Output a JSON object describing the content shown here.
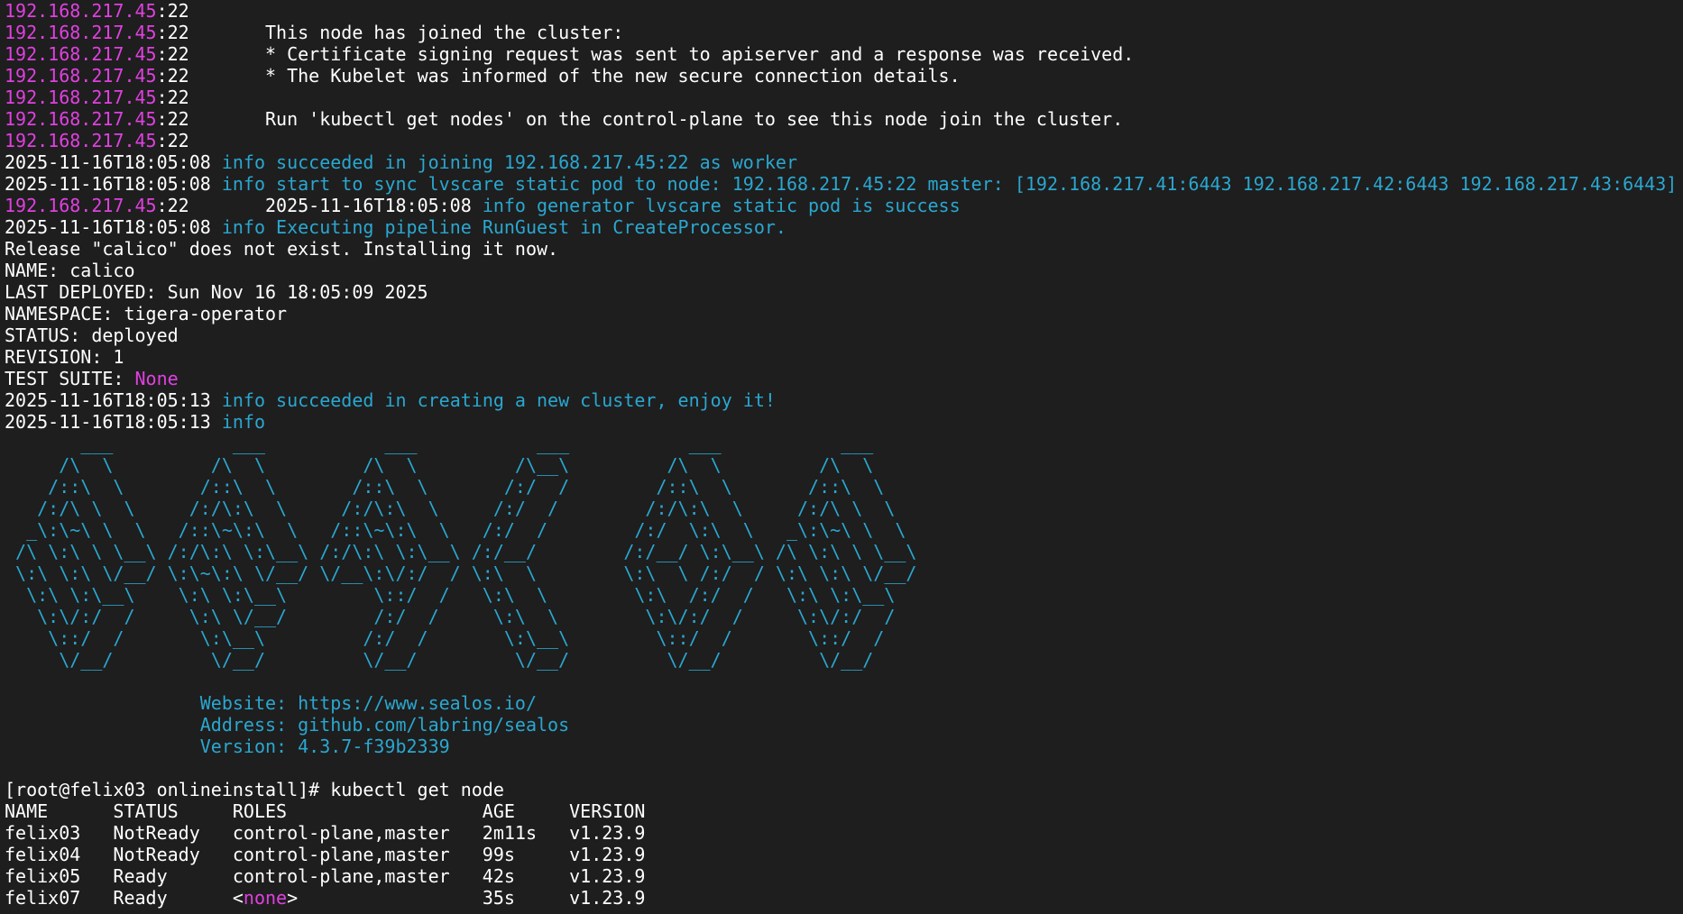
{
  "colors": {
    "background": "#1e1e1e",
    "text": "#ffffff",
    "ip": "#e040e0",
    "info": "#2aa7d0"
  },
  "terminal": {
    "lines": [
      {
        "name": "join-log-line",
        "segments": [
          {
            "c": "ip",
            "t": "192.168.217.45"
          },
          {
            "c": "white",
            "t": ":22"
          }
        ]
      },
      {
        "name": "join-log-line",
        "segments": [
          {
            "c": "ip",
            "t": "192.168.217.45"
          },
          {
            "c": "white",
            "t": ":22       This node has joined the cluster:"
          }
        ]
      },
      {
        "name": "join-log-line",
        "segments": [
          {
            "c": "ip",
            "t": "192.168.217.45"
          },
          {
            "c": "white",
            "t": ":22       * Certificate signing request was sent to apiserver and a response was received."
          }
        ]
      },
      {
        "name": "join-log-line",
        "segments": [
          {
            "c": "ip",
            "t": "192.168.217.45"
          },
          {
            "c": "white",
            "t": ":22       * The Kubelet was informed of the new secure connection details."
          }
        ]
      },
      {
        "name": "join-log-line",
        "segments": [
          {
            "c": "ip",
            "t": "192.168.217.45"
          },
          {
            "c": "white",
            "t": ":22"
          }
        ]
      },
      {
        "name": "join-log-line",
        "segments": [
          {
            "c": "ip",
            "t": "192.168.217.45"
          },
          {
            "c": "white",
            "t": ":22       Run 'kubectl get nodes' on the control-plane to see this node join the cluster."
          }
        ]
      },
      {
        "name": "join-log-line",
        "segments": [
          {
            "c": "ip",
            "t": "192.168.217.45"
          },
          {
            "c": "white",
            "t": ":22"
          }
        ]
      },
      {
        "name": "info-log-line",
        "segments": [
          {
            "c": "white",
            "t": "2025-11-16T18:05:08 "
          },
          {
            "c": "info",
            "t": "info succeeded in joining 192.168.217.45:22 as worker"
          }
        ]
      },
      {
        "name": "info-log-line",
        "segments": [
          {
            "c": "white",
            "t": "2025-11-16T18:05:08 "
          },
          {
            "c": "info",
            "t": "info start to sync lvscare static pod to node: 192.168.217.45:22 master: [192.168.217.41:6443 192.168.217.42:6443 192.168.217.43:6443]"
          }
        ]
      },
      {
        "name": "info-log-line",
        "segments": [
          {
            "c": "ip",
            "t": "192.168.217.45"
          },
          {
            "c": "white",
            "t": ":22       2025-11-16T18:05:08 "
          },
          {
            "c": "info",
            "t": "info generator lvscare static pod is success"
          }
        ]
      },
      {
        "name": "info-log-line",
        "segments": [
          {
            "c": "white",
            "t": "2025-11-16T18:05:08 "
          },
          {
            "c": "info",
            "t": "info Executing pipeline RunGuest in CreateProcessor."
          }
        ]
      },
      {
        "name": "helm-output-line",
        "segments": [
          {
            "c": "white",
            "t": "Release \"calico\" does not exist. Installing it now."
          }
        ]
      },
      {
        "name": "helm-output-line",
        "segments": [
          {
            "c": "white",
            "t": "NAME: calico"
          }
        ]
      },
      {
        "name": "helm-output-line",
        "segments": [
          {
            "c": "white",
            "t": "LAST DEPLOYED: Sun Nov 16 18:05:09 2025"
          }
        ]
      },
      {
        "name": "helm-output-line",
        "segments": [
          {
            "c": "white",
            "t": "NAMESPACE: tigera-operator"
          }
        ]
      },
      {
        "name": "helm-output-line",
        "segments": [
          {
            "c": "white",
            "t": "STATUS: deployed"
          }
        ]
      },
      {
        "name": "helm-output-line",
        "segments": [
          {
            "c": "white",
            "t": "REVISION: 1"
          }
        ]
      },
      {
        "name": "helm-output-line",
        "segments": [
          {
            "c": "white",
            "t": "TEST SUITE: "
          },
          {
            "c": "ip",
            "t": "None"
          }
        ]
      },
      {
        "name": "info-log-line",
        "segments": [
          {
            "c": "white",
            "t": "2025-11-16T18:05:13 "
          },
          {
            "c": "info",
            "t": "info succeeded in creating a new cluster, enjoy it!"
          }
        ]
      },
      {
        "name": "info-log-line",
        "segments": [
          {
            "c": "white",
            "t": "2025-11-16T18:05:13 "
          },
          {
            "c": "info",
            "t": "info"
          }
        ]
      },
      {
        "name": "ascii-banner-line",
        "segments": [
          {
            "c": "info",
            "t": "       ___           ___           ___           ___           ___           ___"
          }
        ]
      },
      {
        "name": "ascii-banner-line",
        "segments": [
          {
            "c": "info",
            "t": "     /\\  \\         /\\  \\         /\\  \\         /\\__\\         /\\  \\         /\\  \\"
          }
        ]
      },
      {
        "name": "ascii-banner-line",
        "segments": [
          {
            "c": "info",
            "t": "    /::\\  \\       /::\\  \\       /::\\  \\       /:/  /        /::\\  \\       /::\\  \\"
          }
        ]
      },
      {
        "name": "ascii-banner-line",
        "segments": [
          {
            "c": "info",
            "t": "   /:/\\ \\  \\     /:/\\:\\  \\     /:/\\:\\  \\     /:/  /        /:/\\:\\  \\     /:/\\ \\  \\"
          }
        ]
      },
      {
        "name": "ascii-banner-line",
        "segments": [
          {
            "c": "info",
            "t": "  _\\:\\~\\ \\  \\   /::\\~\\:\\  \\   /::\\~\\:\\  \\   /:/  /        /:/  \\:\\  \\   _\\:\\~\\ \\  \\"
          }
        ]
      },
      {
        "name": "ascii-banner-line",
        "segments": [
          {
            "c": "info",
            "t": " /\\ \\:\\ \\ \\__\\ /:/\\:\\ \\:\\__\\ /:/\\:\\ \\:\\__\\ /:/__/        /:/__/ \\:\\__\\ /\\ \\:\\ \\ \\__\\"
          }
        ]
      },
      {
        "name": "ascii-banner-line",
        "segments": [
          {
            "c": "info",
            "t": " \\:\\ \\:\\ \\/__/ \\:\\~\\:\\ \\/__/ \\/__\\:\\/:/  / \\:\\  \\        \\:\\  \\ /:/  / \\:\\ \\:\\ \\/__/"
          }
        ]
      },
      {
        "name": "ascii-banner-line",
        "segments": [
          {
            "c": "info",
            "t": "  \\:\\ \\:\\__\\    \\:\\ \\:\\__\\        \\::/  /   \\:\\  \\        \\:\\  /:/  /   \\:\\ \\:\\__\\"
          }
        ]
      },
      {
        "name": "ascii-banner-line",
        "segments": [
          {
            "c": "info",
            "t": "   \\:\\/:/  /     \\:\\ \\/__/        /:/  /     \\:\\  \\        \\:\\/:/  /     \\:\\/:/  /"
          }
        ]
      },
      {
        "name": "ascii-banner-line",
        "segments": [
          {
            "c": "info",
            "t": "    \\::/  /       \\:\\__\\         /:/  /       \\:\\__\\        \\::/  /       \\::/  /"
          }
        ]
      },
      {
        "name": "ascii-banner-line",
        "segments": [
          {
            "c": "info",
            "t": "     \\/__/         \\/__/         \\/__/         \\/__/         \\/__/         \\/__/"
          }
        ]
      },
      {
        "name": "blank-line",
        "segments": [
          {
            "c": "white",
            "t": ""
          }
        ]
      },
      {
        "name": "banner-info-line",
        "segments": [
          {
            "c": "info",
            "t": "                  Website: https://www.sealos.io/"
          }
        ]
      },
      {
        "name": "banner-info-line",
        "segments": [
          {
            "c": "info",
            "t": "                  Address: github.com/labring/sealos"
          }
        ]
      },
      {
        "name": "banner-info-line",
        "segments": [
          {
            "c": "info",
            "t": "                  Version: 4.3.7-f39b2339"
          }
        ]
      },
      {
        "name": "blank-line",
        "segments": [
          {
            "c": "white",
            "t": ""
          }
        ]
      },
      {
        "name": "shell-prompt-line",
        "segments": [
          {
            "c": "white",
            "t": "[root@felix03 onlineinstall]# kubectl get node"
          }
        ]
      },
      {
        "name": "node-table-header",
        "segments": [
          {
            "c": "white",
            "t": "NAME      STATUS     ROLES                  AGE     VERSION"
          }
        ]
      },
      {
        "name": "node-table-row",
        "segments": [
          {
            "c": "white",
            "t": "felix03   NotReady   control-plane,master   2m11s   v1.23.9"
          }
        ]
      },
      {
        "name": "node-table-row",
        "segments": [
          {
            "c": "white",
            "t": "felix04   NotReady   control-plane,master   99s     v1.23.9"
          }
        ]
      },
      {
        "name": "node-table-row",
        "segments": [
          {
            "c": "white",
            "t": "felix05   Ready      control-plane,master   42s     v1.23.9"
          }
        ]
      },
      {
        "name": "node-table-row",
        "segments": [
          {
            "c": "white",
            "t": "felix07   Ready      <"
          },
          {
            "c": "ip",
            "t": "none"
          },
          {
            "c": "white",
            "t": ">                 35s     v1.23.9"
          }
        ]
      }
    ]
  }
}
